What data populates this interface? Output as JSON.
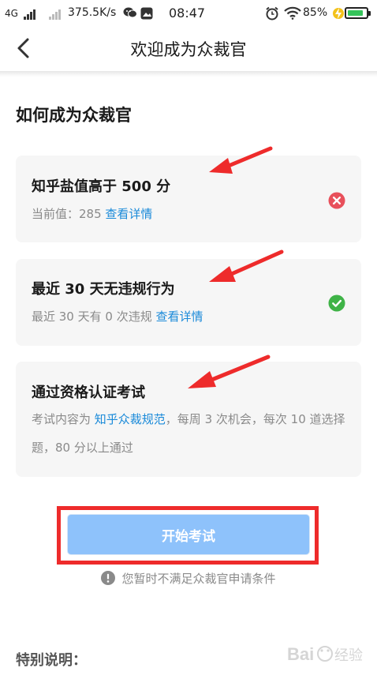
{
  "status_bar": {
    "network": "4G",
    "speed": "375.5K/s",
    "time": "08:47",
    "battery": "85%",
    "battery_level": 0.85,
    "icons": [
      "signal-icon",
      "wechat-icon",
      "image-icon",
      "alarm-icon",
      "wifi-icon",
      "charging-icon",
      "battery-icon"
    ]
  },
  "nav": {
    "back_icon": "chevron-left-icon",
    "title": "欢迎成为众裁官"
  },
  "section_title": "如何成为众裁官",
  "requirements": [
    {
      "title": "知乎盐值高于 500 分",
      "desc_prefix": "当前值：285 ",
      "link": "查看详情",
      "status": "fail",
      "status_icon": "close-circle-icon",
      "status_color": "#e8505b"
    },
    {
      "title": "最近 30 天无违规行为",
      "desc_prefix": "最近 30 天有 0 次违规 ",
      "link": "查看详情",
      "status": "pass",
      "status_icon": "check-circle-icon",
      "status_color": "#3fb347"
    },
    {
      "title": "通过资格认证考试",
      "desc_prefix": "考试内容为 ",
      "link": "知乎众裁规范",
      "desc_suffix": "，每周 3 次机会，每次 10 道选择题，80 分以上通过"
    }
  ],
  "start_button": {
    "label": "开始考试",
    "color": "#8ec2fb"
  },
  "notice": {
    "icon": "info-circle-icon",
    "text": "您暂时不满足众裁官申请条件"
  },
  "special_title": "特别说明：",
  "annotation_color": "#ee2b2b",
  "watermark_text": "Baidu 经验"
}
